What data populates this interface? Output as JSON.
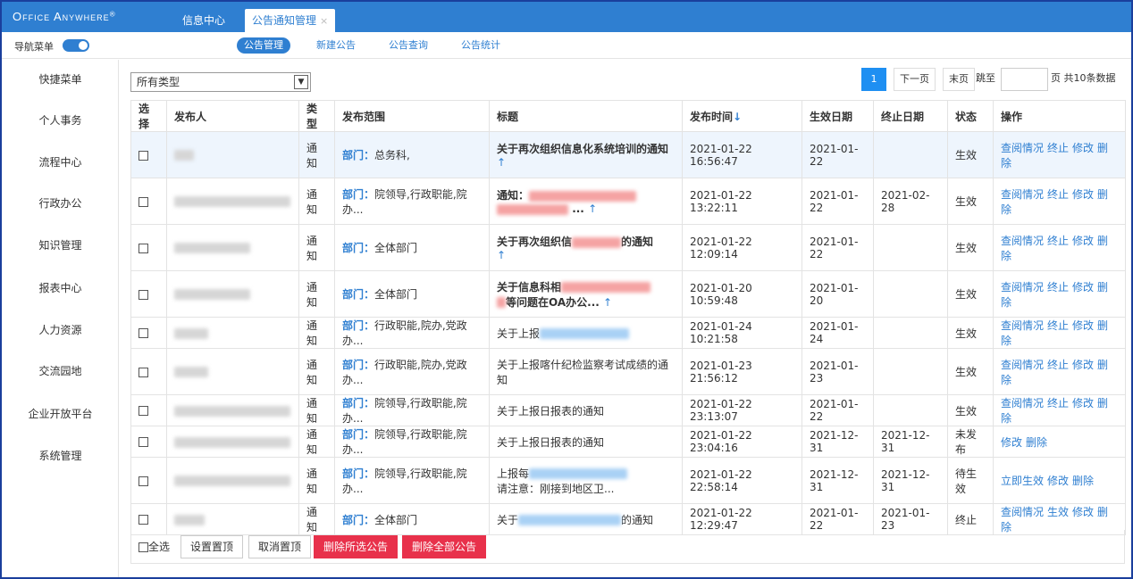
{
  "header": {
    "logo_text": "Office Anywhere",
    "logo_mark": "®",
    "tabs": [
      {
        "label": "信息中心"
      },
      {
        "label": "公告通知管理",
        "close": "×"
      }
    ]
  },
  "nav": {
    "label": "导航菜单",
    "subtabs": [
      "公告管理",
      "新建公告",
      "公告查询",
      "公告统计"
    ]
  },
  "sidebar": {
    "items": [
      "快捷菜单",
      "个人事务",
      "流程中心",
      "行政办公",
      "知识管理",
      "报表中心",
      "人力资源",
      "交流园地",
      "企业开放平台",
      "系统管理"
    ]
  },
  "filter": {
    "type_selected": "所有类型",
    "dropdown_arrow": "▼"
  },
  "pager": {
    "current": "1",
    "next": "下一页",
    "last": "末页",
    "jump_label": "跳至",
    "suffix": "页 共10条数据"
  },
  "table": {
    "columns": [
      "选择",
      "发布人",
      "类型",
      "发布范围",
      "标题",
      "发布时间",
      "生效日期",
      "终止日期",
      "状态",
      "操作"
    ],
    "sort_icon": "↓",
    "up_icon": "↑",
    "rows": [
      {
        "type": "通知",
        "scope_tag": "部门：",
        "scope": "总务科,",
        "title": "关于再次组织信息化系统培训的通知",
        "time": "2021-01-22 16:56:47",
        "start": "2021-01-22",
        "end": "",
        "status": "生效",
        "ops": [
          "查阅情况",
          "终止",
          "修改",
          "删除"
        ]
      },
      {
        "type": "通知",
        "scope_tag": "部门：",
        "scope": "院领导,行政职能,院办...",
        "title": "通知：",
        "title_tail": "...",
        "time": "2021-01-22 13:22:11",
        "start": "2021-01-22",
        "end": "2021-02-28",
        "status": "生效",
        "ops": [
          "查阅情况",
          "终止",
          "修改",
          "删除"
        ]
      },
      {
        "type": "通知",
        "scope_tag": "部门：",
        "scope": "全体部门",
        "title": "关于再次组织信",
        "title_tail": "的通知",
        "time": "2021-01-22 12:09:14",
        "start": "2021-01-22",
        "end": "",
        "status": "生效",
        "ops": [
          "查阅情况",
          "终止",
          "修改",
          "删除"
        ]
      },
      {
        "type": "通知",
        "scope_tag": "部门：",
        "scope": "全体部门",
        "title": "关于信息科相",
        "title_tail": "等问题在OA办公...",
        "time": "2021-01-20 10:59:48",
        "start": "2021-01-20",
        "end": "",
        "status": "生效",
        "ops": [
          "查阅情况",
          "终止",
          "修改",
          "删除"
        ]
      },
      {
        "type": "通知",
        "scope_tag": "部门：",
        "scope": "行政职能,院办,党政办...",
        "title": "关于上报",
        "title_tail": "",
        "time": "2021-01-24 10:21:58",
        "start": "2021-01-24",
        "end": "",
        "status": "生效",
        "ops": [
          "查阅情况",
          "终止",
          "修改",
          "删除"
        ]
      },
      {
        "type": "通知",
        "scope_tag": "部门：",
        "scope": "行政职能,院办,党政办...",
        "title": "关于上报喀什纪检监察考试成绩的通知",
        "title_tail": "",
        "time": "2021-01-23 21:56:12",
        "start": "2021-01-23",
        "end": "",
        "status": "生效",
        "ops": [
          "查阅情况",
          "终止",
          "修改",
          "删除"
        ]
      },
      {
        "type": "通知",
        "scope_tag": "部门：",
        "scope": "院领导,行政职能,院办...",
        "title": "关于上报日报表的通知",
        "title_tail": "",
        "time": "2021-01-22 23:13:07",
        "start": "2021-01-22",
        "end": "",
        "status": "生效",
        "ops": [
          "查阅情况",
          "终止",
          "修改",
          "删除"
        ]
      },
      {
        "type": "通知",
        "scope_tag": "部门：",
        "scope": "院领导,行政职能,院办...",
        "title": "关于上报日报表的通知",
        "title_tail": "",
        "time": "2021-01-22 23:04:16",
        "start": "2021-12-31",
        "end": "2021-12-31",
        "status": "未发布",
        "ops": [
          "修改",
          "删除"
        ]
      },
      {
        "type": "通知",
        "scope_tag": "部门：",
        "scope": "院领导,行政职能,院办...",
        "title": "上报每",
        "title_tail": "请注意：刚接到地区卫...",
        "time": "2021-01-22 22:58:14",
        "start": "2021-12-31",
        "end": "2021-12-31",
        "status": "待生效",
        "ops": [
          "立即生效",
          "修改",
          "删除"
        ]
      },
      {
        "type": "通知",
        "scope_tag": "部门：",
        "scope": "全体部门",
        "title": "关于",
        "title_tail": "的通知",
        "time": "2021-01-22 12:29:47",
        "start": "2021-01-22",
        "end": "2021-01-23",
        "status": "终止",
        "ops": [
          "查阅情况",
          "生效",
          "修改",
          "删除"
        ]
      }
    ]
  },
  "bottom": {
    "select_all": "全选",
    "set_top": "设置置顶",
    "cancel_top": "取消置顶",
    "delete_selected": "删除所选公告",
    "delete_all": "删除全部公告"
  },
  "colors": {
    "accent": "#2f7fd1",
    "danger": "#e8314b",
    "success": "#1ca51c"
  }
}
